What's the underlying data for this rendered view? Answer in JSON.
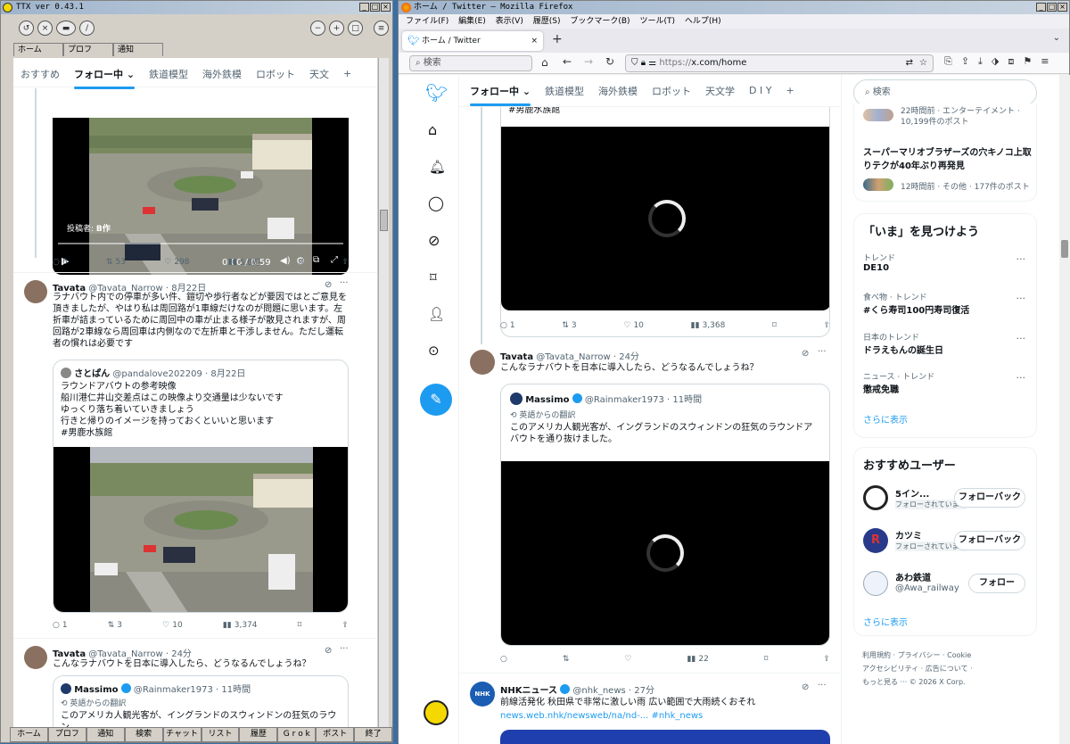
{
  "ttx": {
    "title": "TTX  ver 0.43.1",
    "top_tabs": [
      "ホーム",
      "プロフ",
      "通知"
    ],
    "feed_tabs": [
      "おすすめ",
      "フォロー中",
      "鉄道模型",
      "海外鉄模",
      "ロボット",
      "天文"
    ],
    "video1": {
      "poster_label": "投稿者:",
      "poster_name": "B作",
      "time": "0:00 / 0:59"
    },
    "post1_actions": {
      "replies": "6",
      "reposts": "53",
      "likes": "298",
      "views": "5.8万"
    },
    "post2": {
      "name": "Tavata",
      "handle": "@Tavata_Narrow · 8月22日",
      "text": "ラナバウト内での停車が多い件、鎧切や歩行者などが要因ではとご意見を頂きましたが、やはり私は周回路が1車線だけなのが問題に思います。左折車が詰まっているために周回中の車が止まる様子が散見されますが、周回路が2車線なら周回車は内側なので左折車と干渉しません。ただし運転者の慣れは必要です",
      "quote_name": "さとぱん",
      "quote_handle": "@pandalove202209 · 8月22日",
      "quote_text": [
        "ラウンドアバウトの参考映像",
        "船川港仁井山交差点はこの映像より交通量は少ないです",
        "ゆっくり落ち着いていきましょう",
        "行きと帰りのイメージを持っておくといいと思います",
        "#男鹿水族館"
      ],
      "actions": {
        "replies": "1",
        "reposts": "3",
        "likes": "10",
        "views": "3,374"
      }
    },
    "post3": {
      "name": "Tavata",
      "handle": "@Tavata_Narrow · 24分",
      "text": "こんなラナバウトを日本に導入したら、どうなるんでしょうね？",
      "quote_name": "Massimo",
      "quote_handle": "@Rainmaker1973 · 11時間",
      "translate": "英語からの翻訳",
      "quote_text": "このアメリカ人観光客が、イングランドのスウィンドンの狂気のラウン"
    },
    "bottom_bar": [
      "ホーム",
      "プロフ",
      "通知",
      "検索",
      "チャット",
      "リスト",
      "履歴",
      "G r o k",
      "ポスト",
      "終了"
    ]
  },
  "firefox": {
    "title": "ホーム / Twitter — Mozilla Firefox",
    "menu": [
      "ファイル(F)",
      "編集(E)",
      "表示(V)",
      "履歴(S)",
      "ブックマーク(B)",
      "ツール(T)",
      "ヘルプ(H)"
    ],
    "tab_title": "ホーム / Twitter",
    "search_placeholder": "検索",
    "url_prefix": "https://",
    "url": "x.com/home"
  },
  "x": {
    "feed_tabs": [
      "フォロー中",
      "鉄道模型",
      "海外鉄模",
      "ロボット",
      "天文学",
      "D I Y"
    ],
    "hashtag_top": "#男鹿水族館",
    "post1_actions": {
      "replies": "1",
      "reposts": "3",
      "likes": "10",
      "views": "3,368"
    },
    "post2": {
      "name": "Tavata",
      "handle": "@Tavata_Narrow · 24分",
      "text": "こんなラナバウトを日本に導入したら、どうなるんでしょうね？",
      "quote_name": "Massimo",
      "quote_handle": "@Rainmaker1973 · 11時間",
      "translate": "英語からの翻訳",
      "quote_text": "このアメリカ人観光客が、イングランドのスウィンドンの狂気のラウンドアバウトを通り抜けました。",
      "actions": {
        "views": "22"
      }
    },
    "post3": {
      "name": "NHKニュース",
      "handle": "@nhk_news · 27分",
      "text": "前線活発化 秋田県で非常に激しい雨 広い範囲で大雨続くおそれ",
      "link": "news.web.nhk/newsweb/na/nd-... #nhk_news"
    },
    "right": {
      "search_placeholder": "検索",
      "top_meta1": "22時間前 · エンターテイメント ·",
      "top_meta2": "10,199件のポスト",
      "news_title": "スーパーマリオブラザーズの穴キノコ上取りテクが40年ぶり再発見",
      "news_meta": "12時間前 · その他 · 177件のポスト",
      "trends_title": "「いま」を見つけよう",
      "trends": [
        {
          "meta": "トレンド",
          "title": "DE10"
        },
        {
          "meta": "食べ物 · トレンド",
          "title": "#くら寿司100円寿司復活"
        },
        {
          "meta": "日本のトレンド",
          "title": "ドラえもんの誕生日"
        },
        {
          "meta": "ニュース · トレンド",
          "title": "懲戒免職"
        }
      ],
      "show_more": "さらに表示",
      "who_title": "おすすめユーザー",
      "users": [
        {
          "name": "5イン...",
          "sub": "フォローされています",
          "button": "フォローバック"
        },
        {
          "name": "カツミ",
          "sub": "フォローされています",
          "button": "フォローバック"
        },
        {
          "name": "あわ鉄道",
          "sub": "@Awa_railway",
          "button": "フォロー"
        }
      ],
      "show_more2": "さらに表示",
      "footer": [
        "利用規約",
        "プライバシー",
        "Cookie",
        "アクセシビリティ",
        "広告について",
        "もっと見る ···",
        "© 2026 X Corp."
      ]
    }
  }
}
